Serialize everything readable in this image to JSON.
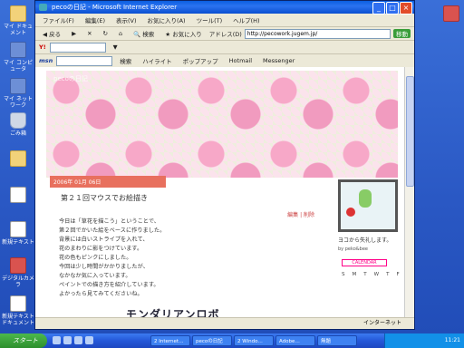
{
  "desktop": {
    "icons": [
      {
        "label": "マイ ドキュメント",
        "icon": "folder"
      },
      {
        "label": "マイ コンピュータ",
        "icon": "mon"
      },
      {
        "label": "マイ ネットワーク",
        "icon": "mon"
      },
      {
        "label": "ごみ箱",
        "icon": "trash"
      },
      {
        "label": "",
        "icon": "folder"
      },
      {
        "label": "",
        "icon": "doc"
      },
      {
        "label": "新規テキスト",
        "icon": "doc"
      },
      {
        "label": "デジタルカメラ",
        "icon": "red"
      },
      {
        "label": "新規テキスト ドキュメント",
        "icon": "doc"
      }
    ]
  },
  "browser": {
    "title": "pecoの日記 - Microsoft Internet Explorer",
    "menu": [
      "ファイル(F)",
      "編集(E)",
      "表示(V)",
      "お気に入り(A)",
      "ツール(T)",
      "ヘルプ(H)"
    ],
    "toolbar": {
      "back": "戻る",
      "search": "検索",
      "favorites": "お気に入り"
    },
    "address_label": "アドレス(D)",
    "address_value": "http://pecowork.jugem.jp/",
    "go_label": "移動",
    "yahoo_label": "Y!",
    "msn_label": "msn",
    "links": [
      "検索",
      "ハイライト",
      "ポップアップ",
      "Hotmail",
      "Messenger"
    ],
    "status_text": "",
    "zone_text": "インターネット"
  },
  "page": {
    "site_title": "pecoの日記",
    "date": "2006年 01月 06日",
    "post_title": "第２１回マウスでお絵描き",
    "meta": "編集 | 削除",
    "lines": [
      "今日は「草花を描こう」ということで、",
      "第２回でかいた絵をベースに作りました。",
      "背景には白いストライプを入れて、",
      "花のまわりに影をつけています。",
      "花の色もピンクにしました。",
      "今回は少し時間がかかりましたが、",
      "なかなか気に入っています。",
      "ペイントでの描き方を紹介しています。",
      "よかったら見てみてくださいね。"
    ],
    "logo_text": "モンダリアンロボ",
    "side_caption": "ヨコから失礼します。",
    "side_by": "by peko&bee",
    "calendar_title": "CALENDAR",
    "calendar_days": [
      "S",
      "M",
      "T",
      "W",
      "T",
      "F",
      "S"
    ]
  },
  "taskbar": {
    "start": "スタート",
    "tasks": [
      "2 Internet…",
      "pecoの日記",
      "2 Windo…",
      "Adobe…",
      "無題"
    ],
    "clock": "11:21"
  }
}
